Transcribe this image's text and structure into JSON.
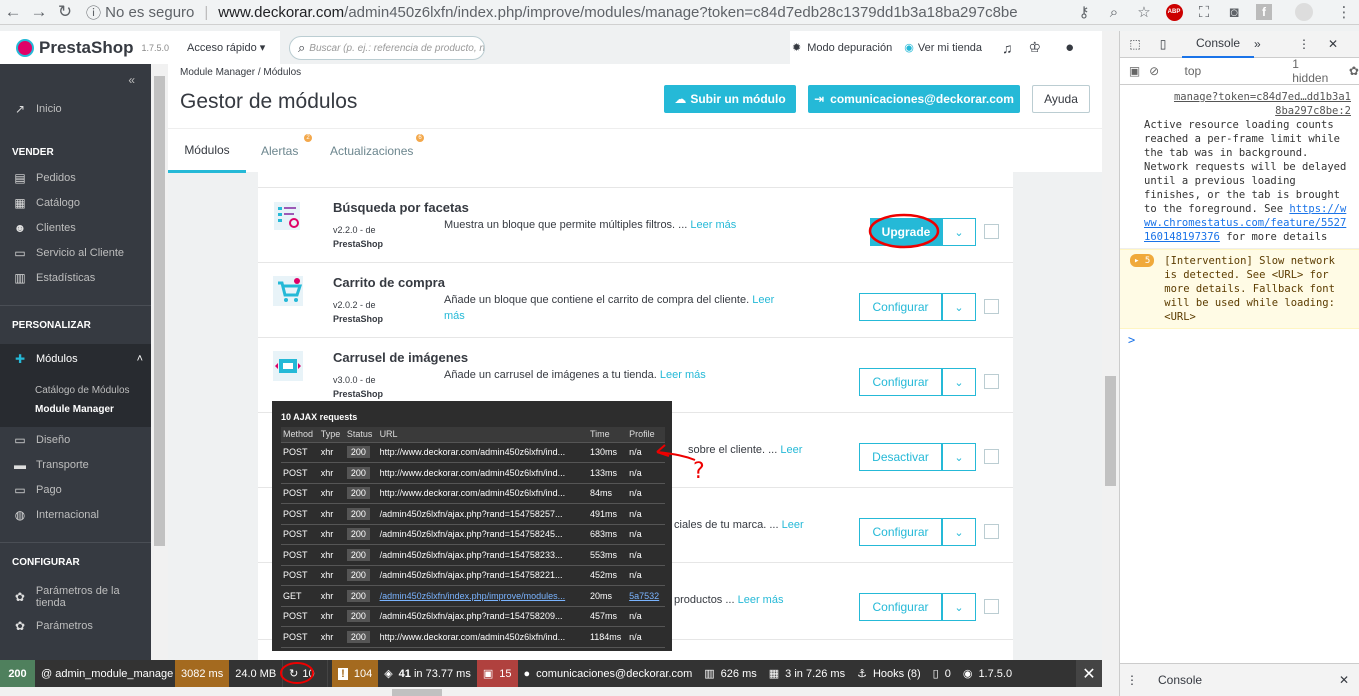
{
  "browser": {
    "security": "No es seguro",
    "url_host": "www.deckorar.com",
    "url_path": "/admin450z6lxfn/index.php/improve/modules/manage?token=c84d7edb28c1379dd1b3a18ba297c8be",
    "ext_abp": "ABP"
  },
  "header": {
    "brand": "PrestaShop",
    "version": "1.7.5.0",
    "quick_access": "Acceso rápido",
    "search_placeholder": "Buscar (p. ej.: referencia de producto, nombre de cliente...)",
    "debug_mode": "Modo depuración",
    "view_store": "Ver mi tienda"
  },
  "sidebar": {
    "home": "Inicio",
    "sec_sell": "VENDER",
    "orders": "Pedidos",
    "catalog": "Catálogo",
    "customers": "Clientes",
    "service": "Servicio al Cliente",
    "stats": "Estadísticas",
    "sec_custom": "PERSONALIZAR",
    "modules": "Módulos",
    "catalog_modules": "Catálogo de Módulos",
    "module_manager": "Module Manager",
    "design": "Diseño",
    "shipping": "Transporte",
    "payment": "Pago",
    "international": "Internacional",
    "sec_config": "CONFIGURAR",
    "params_store": "Parámetros de la tienda",
    "params": "Parámetros"
  },
  "page": {
    "breadcrumb": "Module Manager  /  Módulos",
    "title": "Gestor de módulos",
    "upload_btn": "Subir un módulo",
    "account_btn": "comunicaciones@deckorar.com",
    "help_btn": "Ayuda",
    "tab_modules": "Módulos",
    "tab_alerts": "Alertas",
    "tab_updates": "Actualizaciones",
    "alerts_badge": "2",
    "updates_badge": "6"
  },
  "modules": [
    {
      "name": "Búsqueda por facetas",
      "ver": "v2.2.0 - de",
      "author": "PrestaShop",
      "desc": "Muestra un bloque que permite múltiples filtros. ...",
      "more": "Leer más",
      "action": "Upgrade"
    },
    {
      "name": "Carrito de compra",
      "ver": "v2.0.2 - de",
      "author": "PrestaShop",
      "desc": "Añade un bloque que contiene el carrito de compra del cliente.",
      "more": "Leer más",
      "action": "Configurar"
    },
    {
      "name": "Carrusel de imágenes",
      "ver": "v3.0.0 - de",
      "author": "PrestaShop",
      "desc": "Añade un carrusel de imágenes a tu tienda.",
      "more": "Leer más",
      "action": "Configurar"
    },
    {
      "desc": "sobre el cliente. ...",
      "more": "Leer",
      "action": "Desactivar"
    },
    {
      "desc": "ciales de tu marca. ...",
      "more": "Leer",
      "action": "Configurar"
    },
    {
      "desc": "productos ...",
      "more": "Leer más",
      "action": "Configurar"
    }
  ],
  "ajax": {
    "title": "10 AJAX requests",
    "headers": [
      "Method",
      "Type",
      "Status",
      "URL",
      "Time",
      "Profile"
    ],
    "rows": [
      [
        "POST",
        "xhr",
        "200",
        "http://www.deckorar.com/admin450z6lxfn/ind...",
        "130ms",
        "n/a"
      ],
      [
        "POST",
        "xhr",
        "200",
        "http://www.deckorar.com/admin450z6lxfn/ind...",
        "133ms",
        "n/a"
      ],
      [
        "POST",
        "xhr",
        "200",
        "http://www.deckorar.com/admin450z6lxfn/ind...",
        "84ms",
        "n/a"
      ],
      [
        "POST",
        "xhr",
        "200",
        "/admin450z6lxfn/ajax.php?rand=154758257...",
        "491ms",
        "n/a"
      ],
      [
        "POST",
        "xhr",
        "200",
        "/admin450z6lxfn/ajax.php?rand=154758245...",
        "683ms",
        "n/a"
      ],
      [
        "POST",
        "xhr",
        "200",
        "/admin450z6lxfn/ajax.php?rand=154758233...",
        "553ms",
        "n/a"
      ],
      [
        "POST",
        "xhr",
        "200",
        "/admin450z6lxfn/ajax.php?rand=154758221...",
        "452ms",
        "n/a"
      ],
      [
        "GET",
        "xhr",
        "200",
        "/admin450z6lxfn/index.php/improve/modules...",
        "20ms",
        "5a7532"
      ],
      [
        "POST",
        "xhr",
        "200",
        "/admin450z6lxfn/ajax.php?rand=154758209...",
        "457ms",
        "n/a"
      ],
      [
        "POST",
        "xhr",
        "200",
        "http://www.deckorar.com/admin450z6lxfn/ind...",
        "1184ms",
        "n/a"
      ]
    ]
  },
  "profiler": {
    "status": "200",
    "route": "@ admin_module_manage",
    "time": "3082 ms",
    "memory": "24.0 MB",
    "ajax_count": "10",
    "warnings": "104",
    "queries": "41",
    "queries_time": "in 73.77 ms",
    "twig": "15",
    "user": "comunicaciones@deckorar.com",
    "render": "626 ms",
    "cache": "3",
    "cache_time": "in 7.26 ms",
    "hooks": "Hooks (8)",
    "zero": "0",
    "version": "1.7.5.0"
  },
  "devtools": {
    "tab": "Console",
    "context": "top",
    "hidden": "1 hidden",
    "link1": "manage?token=c84d7ed…dd1b3a1",
    "link2": "8ba297c8be:2",
    "msg1": "Active resource loading counts reached a per-frame limit while the tab was in background. Network requests will be delayed until a previous loading finishes, or the tab is brought to the foreground. See",
    "msg1_link": "https://www.chromestatus.com/feature/5527160148197376",
    "msg1_tail": "for more details",
    "badge": "5",
    "msg2": "[Intervention] Slow network is detected. See <URL> for more details. Fallback font will be used while loading: <URL>",
    "prompt": ">",
    "drawer": "Console"
  }
}
